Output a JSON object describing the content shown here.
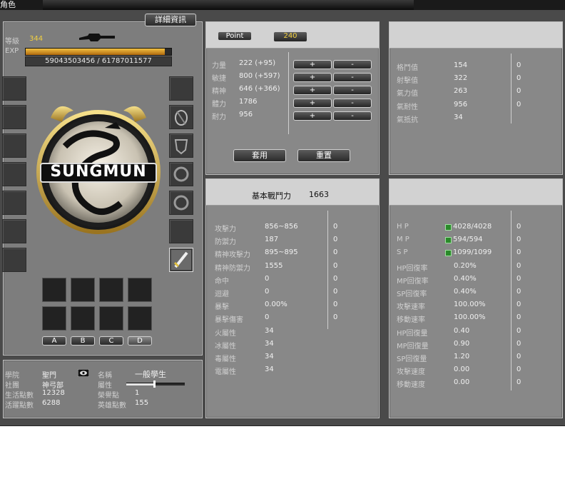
{
  "window": {
    "title": "角色"
  },
  "detail_button": "詳細資訊",
  "left": {
    "level_label": "等級",
    "level_value": "344",
    "exp_label": "EXP",
    "exp_value": "59043503456 / 61787011577",
    "exp_progress": 0.956,
    "emblem_text": "SUNGMUN",
    "tab_labels": [
      "A",
      "B",
      "C",
      "D"
    ]
  },
  "info": {
    "school_label": "學院",
    "school_value": "聖門",
    "club_label": "社團",
    "club_value": "神弓部",
    "life_label": "生活點數",
    "life_value": "12328",
    "activity_label": "活躍點數",
    "activity_value": "6288",
    "name_label": "名稱",
    "name_value": "一般學生",
    "attr_label": "屬性",
    "honor_label": "榮譽點",
    "honor_value": "1",
    "hero_label": "英雄點數",
    "hero_value": "155"
  },
  "stats": {
    "point_label": "Point",
    "point_value": "240",
    "rows": [
      {
        "label": "力量",
        "value": "222 (+95)"
      },
      {
        "label": "敏捷",
        "value": "800 (+597)"
      },
      {
        "label": "精神",
        "value": "646 (+366)"
      },
      {
        "label": "體力",
        "value": "1786"
      },
      {
        "label": "耐力",
        "value": "956"
      }
    ],
    "plus": "+",
    "minus": "-",
    "apply_label": "套用",
    "reset_label": "重置"
  },
  "combat": {
    "header_label": "基本戰鬥力",
    "header_value": "1663",
    "rows": [
      {
        "label": "攻擊力",
        "value": "856~856",
        "extra": "0"
      },
      {
        "label": "防禦力",
        "value": "187",
        "extra": "0"
      },
      {
        "label": "精神攻擊力",
        "value": "895~895",
        "extra": "0"
      },
      {
        "label": "精神防禦力",
        "value": "1555",
        "extra": "0"
      },
      {
        "label": "命中",
        "value": "0",
        "extra": "0"
      },
      {
        "label": "迴避",
        "value": "0",
        "extra": "0"
      },
      {
        "label": "暴擊",
        "value": "0.00%",
        "extra": "0"
      },
      {
        "label": "暴擊傷害",
        "value": "0",
        "extra": "0"
      },
      {
        "label": "火屬性",
        "value": "34",
        "extra": ""
      },
      {
        "label": "冰屬性",
        "value": "34",
        "extra": ""
      },
      {
        "label": "毒屬性",
        "value": "34",
        "extra": ""
      },
      {
        "label": "電屬性",
        "value": "34",
        "extra": ""
      }
    ]
  },
  "resist": {
    "rows": [
      {
        "label": "格鬥值",
        "value": "154",
        "extra": "0"
      },
      {
        "label": "射擊值",
        "value": "322",
        "extra": "0"
      },
      {
        "label": "氣力值",
        "value": "263",
        "extra": "0"
      },
      {
        "label": "氣耐性",
        "value": "956",
        "extra": "0"
      },
      {
        "label": "氣抵抗",
        "value": "34",
        "extra": ""
      }
    ]
  },
  "vitals": {
    "rows": [
      {
        "label": "H P",
        "value": "4028/4028",
        "extra": "0",
        "icon": true
      },
      {
        "label": "M P",
        "value": "594/594",
        "extra": "0",
        "icon": true
      },
      {
        "label": "S P",
        "value": "1099/1099",
        "extra": "0",
        "icon": true
      },
      {
        "label": "HP回復率",
        "value": "0.20%",
        "extra": "0"
      },
      {
        "label": "MP回復率",
        "value": "0.40%",
        "extra": "0"
      },
      {
        "label": "SP回復率",
        "value": "0.40%",
        "extra": "0"
      },
      {
        "label": "攻擊速率",
        "value": "100.00%",
        "extra": "0"
      },
      {
        "label": "移動速率",
        "value": "100.00%",
        "extra": "0"
      },
      {
        "label": "HP回復量",
        "value": "0.40",
        "extra": "0"
      },
      {
        "label": "MP回復量",
        "value": "0.90",
        "extra": "0"
      },
      {
        "label": "SP回復量",
        "value": "1.20",
        "extra": "0"
      },
      {
        "label": "攻擊速度",
        "value": "0.00",
        "extra": "0"
      },
      {
        "label": "移動速度",
        "value": "0.00",
        "extra": "0"
      }
    ]
  }
}
